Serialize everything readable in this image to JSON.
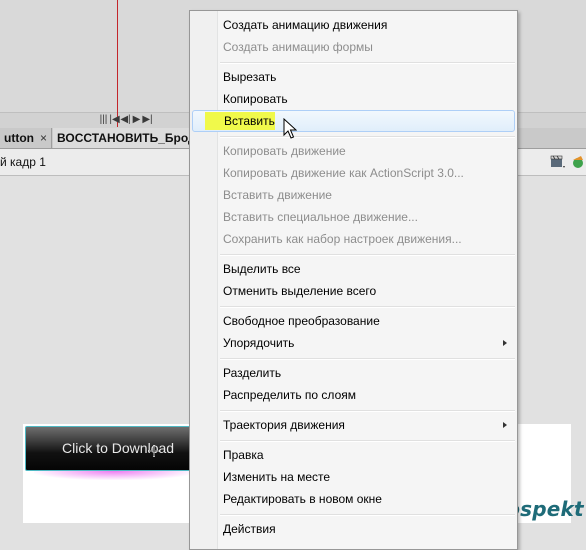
{
  "transport": {
    "left_controls": [
      "|||",
      "|◀",
      "◀|",
      "▶",
      "▶|"
    ]
  },
  "tabs": [
    {
      "label": "utton",
      "close": "×"
    },
    {
      "label": "ВОССТАНОВИТЬ_Бродь",
      "close": ""
    }
  ],
  "editbar": {
    "scene_label": "й кадр 1"
  },
  "stage": {
    "button_label": "Click to Download"
  },
  "watermark": "novprospekt",
  "context_menu": {
    "items": [
      {
        "label": "Создать анимацию движения",
        "enabled": true
      },
      {
        "label": "Создать анимацию формы",
        "enabled": false
      },
      {
        "label": "Вырезать",
        "enabled": true
      },
      {
        "label": "Копировать",
        "enabled": true
      },
      {
        "label": "Вставить",
        "enabled": true,
        "highlighted": true
      },
      {
        "label": "Копировать движение",
        "enabled": false
      },
      {
        "label": "Копировать движение как ActionScript 3.0...",
        "enabled": false
      },
      {
        "label": "Вставить движение",
        "enabled": false
      },
      {
        "label": "Вставить специальное движение...",
        "enabled": false
      },
      {
        "label": "Сохранить как набор настроек движения...",
        "enabled": false
      },
      {
        "label": "Выделить все",
        "enabled": true
      },
      {
        "label": "Отменить выделение всего",
        "enabled": true
      },
      {
        "label": "Свободное преобразование",
        "enabled": true
      },
      {
        "label": "Упорядочить",
        "enabled": true,
        "submenu": true
      },
      {
        "label": "Разделить",
        "enabled": true
      },
      {
        "label": "Распределить по слоям",
        "enabled": true
      },
      {
        "label": "Траектория движения",
        "enabled": true,
        "submenu": true
      },
      {
        "label": "Правка",
        "enabled": true
      },
      {
        "label": "Изменить на месте",
        "enabled": true
      },
      {
        "label": "Редактировать в новом окне",
        "enabled": true
      },
      {
        "label": "Действия",
        "enabled": true
      }
    ]
  },
  "colors": {
    "menu_highlight_marker": "#f0f94b",
    "menu_disabled_text": "#8d8d8d",
    "button_border": "#4fb9c4",
    "watermark": "#1e6b78"
  },
  "icons": [
    "playhead",
    "transport-controls",
    "tab-close-icon",
    "edit-scene-icon",
    "edit-symbol-icon",
    "submenu-arrow-icon",
    "mouse-pointer-icon"
  ]
}
